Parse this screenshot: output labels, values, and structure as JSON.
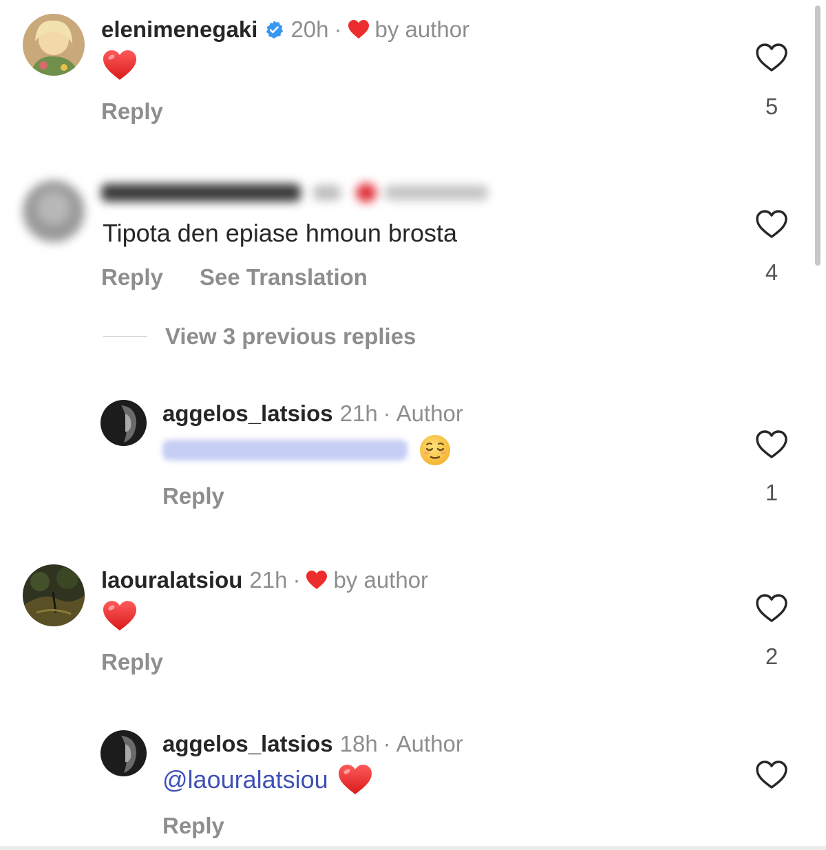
{
  "comments": [
    {
      "username": "elenimenegaki",
      "verified": true,
      "time": "20h",
      "liked_by_author": "by author",
      "text_emoji": "heart",
      "actions": [
        "Reply"
      ],
      "likes": "5"
    },
    {
      "username": "",
      "time": "",
      "liked_by_author": "",
      "text": "Tipota den epiase hmoun brosta",
      "actions": [
        "Reply",
        "See Translation"
      ],
      "likes": "4",
      "blurred_identity": true
    },
    {
      "username": "aggelos_latsios",
      "time": "21h",
      "badge": "Author",
      "mention": "",
      "emoji": "relieved-face",
      "actions": [
        "Reply"
      ],
      "likes": "1",
      "is_reply": true
    },
    {
      "username": "laouralatsiou",
      "time": "21h",
      "liked_by_author": "by author",
      "text_emoji": "heart",
      "actions": [
        "Reply"
      ],
      "likes": "2"
    },
    {
      "username": "aggelos_latsios",
      "time": "18h",
      "badge": "Author",
      "mention": "@laouralatsiou",
      "emoji": "heart",
      "actions": [
        "Reply"
      ],
      "likes": "",
      "is_reply": true
    }
  ],
  "view_replies": "View 3 previous replies",
  "separator": "·",
  "colors": {
    "heart_red": "#ed2d2d",
    "verified_blue": "#3897f0",
    "mention_blue": "#3f51b5",
    "muted_text": "#8e8e8e"
  }
}
